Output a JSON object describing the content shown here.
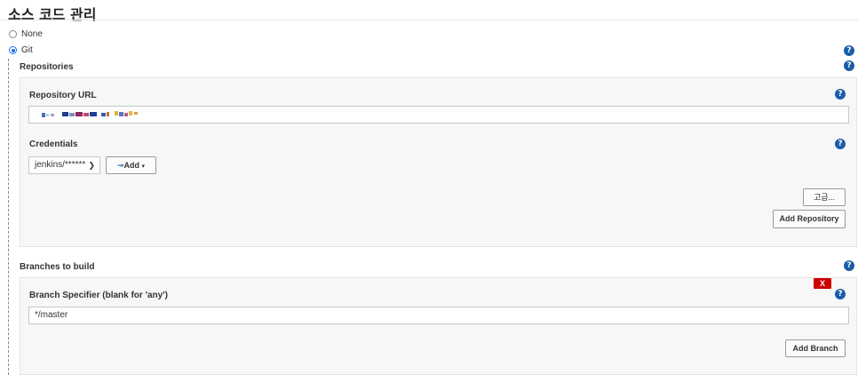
{
  "section": {
    "title": "소스 코드 관리"
  },
  "scm": {
    "options": [
      {
        "label": "None",
        "selected": false
      },
      {
        "label": "Git",
        "selected": true
      }
    ]
  },
  "help_glyph": "?",
  "repositories": {
    "title": "Repositories",
    "url_label": "Repository URL",
    "url_value_obscured": true,
    "credentials_label": "Credentials",
    "credentials_selected": "jenkins/******",
    "add_button": "Add",
    "advanced_button": "고급...",
    "add_repository_button": "Add Repository"
  },
  "branches": {
    "title": "Branches to build",
    "specifier_label": "Branch Specifier (blank for 'any')",
    "specifier_value": "*/master",
    "delete_button": "X",
    "add_branch_button": "Add Branch"
  },
  "colors": {
    "help_icon": "#1a5ea8",
    "delete_red": "#cc0000",
    "panel_bg": "#f7f7f7",
    "radio_checked": "#1a73e8"
  }
}
